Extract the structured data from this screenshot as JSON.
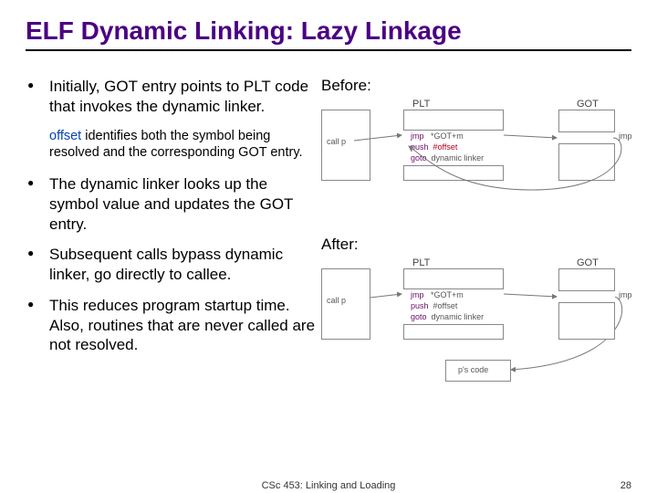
{
  "title": "ELF Dynamic Linking: Lazy Linkage",
  "bullets": {
    "b1": "Initially, GOT entry points to PLT code that invokes the dynamic linker.",
    "sub_offset": "offset",
    "sub_rest": " identifies both the symbol being resolved and the corresponding GOT entry.",
    "b2": "The dynamic linker looks up the symbol value and updates the GOT entry.",
    "b3": "Subsequent calls bypass dynamic linker, go directly to callee.",
    "b4": "This reduces program startup time.  Also, routines that are never called are not resolved."
  },
  "diagrams": {
    "before_label": "Before:",
    "after_label": "After:",
    "plt_label": "PLT",
    "got_label": "GOT",
    "call_p": "call p",
    "jmp_got": "jmp   *GOT+m",
    "push_off": "push  ",
    "push_off_val": "#offset",
    "goto_dl": "goto  ",
    "goto_dl_val": "dynamic linker",
    "ps_code": "p's code"
  },
  "footer": {
    "center": "CSc 453: Linking and Loading",
    "page": "28"
  }
}
